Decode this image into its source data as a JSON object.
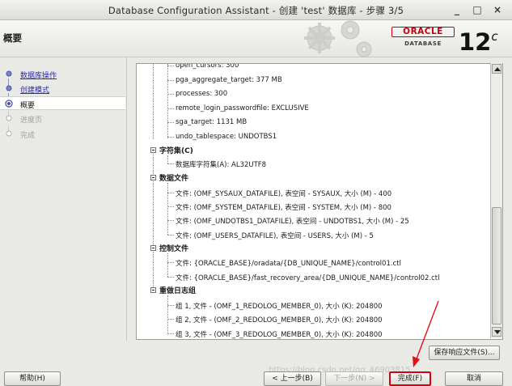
{
  "window": {
    "title": "Database Configuration Assistant - 创建 'test' 数据库 - 步骤 3/5",
    "controls": {
      "minimize": "_",
      "maximize": "□",
      "close": "×"
    }
  },
  "header": {
    "page_title": "概要",
    "logo": {
      "brand": "ORACLE",
      "subtitle": "DATABASE",
      "version": "12",
      "version_suffix": "c"
    }
  },
  "sidebar": {
    "steps": [
      {
        "label": "数据库操作",
        "state": "done"
      },
      {
        "label": "创建模式",
        "state": "done"
      },
      {
        "label": "概要",
        "state": "current"
      },
      {
        "label": "进度页",
        "state": "future"
      },
      {
        "label": "完成",
        "state": "future"
      }
    ]
  },
  "summary": {
    "params": [
      "open_cursors: 300",
      "pga_aggregate_target: 377 MB",
      "processes: 300",
      "remote_login_passwordfile: EXCLUSIVE",
      "sga_target: 1131 MB",
      "undo_tablespace: UNDOTBS1"
    ],
    "sections": [
      {
        "title": "字符集(C)",
        "items": [
          "数据库字符集(A): AL32UTF8"
        ]
      },
      {
        "title": "数据文件",
        "items": [
          "文件: (OMF_SYSAUX_DATAFILE), 表空间 - SYSAUX, 大小 (M) - 400",
          "文件: (OMF_SYSTEM_DATAFILE), 表空间 - SYSTEM, 大小 (M) - 800",
          "文件: (OMF_UNDOTBS1_DATAFILE), 表空间 - UNDOTBS1, 大小 (M) - 25",
          "文件: (OMF_USERS_DATAFILE), 表空间 - USERS, 大小 (M) - 5"
        ]
      },
      {
        "title": "控制文件",
        "items": [
          "文件: {ORACLE_BASE}/oradata/{DB_UNIQUE_NAME}/control01.ctl",
          "文件: {ORACLE_BASE}/fast_recovery_area/{DB_UNIQUE_NAME}/control02.ctl"
        ]
      },
      {
        "title": "重做日志组",
        "items": [
          "组 1, 文件 - (OMF_1_REDOLOG_MEMBER_0), 大小 (K): 204800",
          "组 2, 文件 - (OMF_2_REDOLOG_MEMBER_0), 大小 (K): 204800",
          "组 3, 文件 - (OMF_3_REDOLOG_MEMBER_0), 大小 (K): 204800"
        ]
      }
    ]
  },
  "buttons": {
    "save_response": "保存响应文件(S)...",
    "help": "帮助(H)",
    "back": "< 上一步(B)",
    "next": "下一步(N) >",
    "finish": "完成(F)",
    "cancel": "取消"
  },
  "watermark": "https://blog.csdn.net/qq_46903815",
  "colors": {
    "oracle_red": "#c7000b",
    "link_blue": "#2a2aa8",
    "arrow_red": "#e2101a"
  }
}
